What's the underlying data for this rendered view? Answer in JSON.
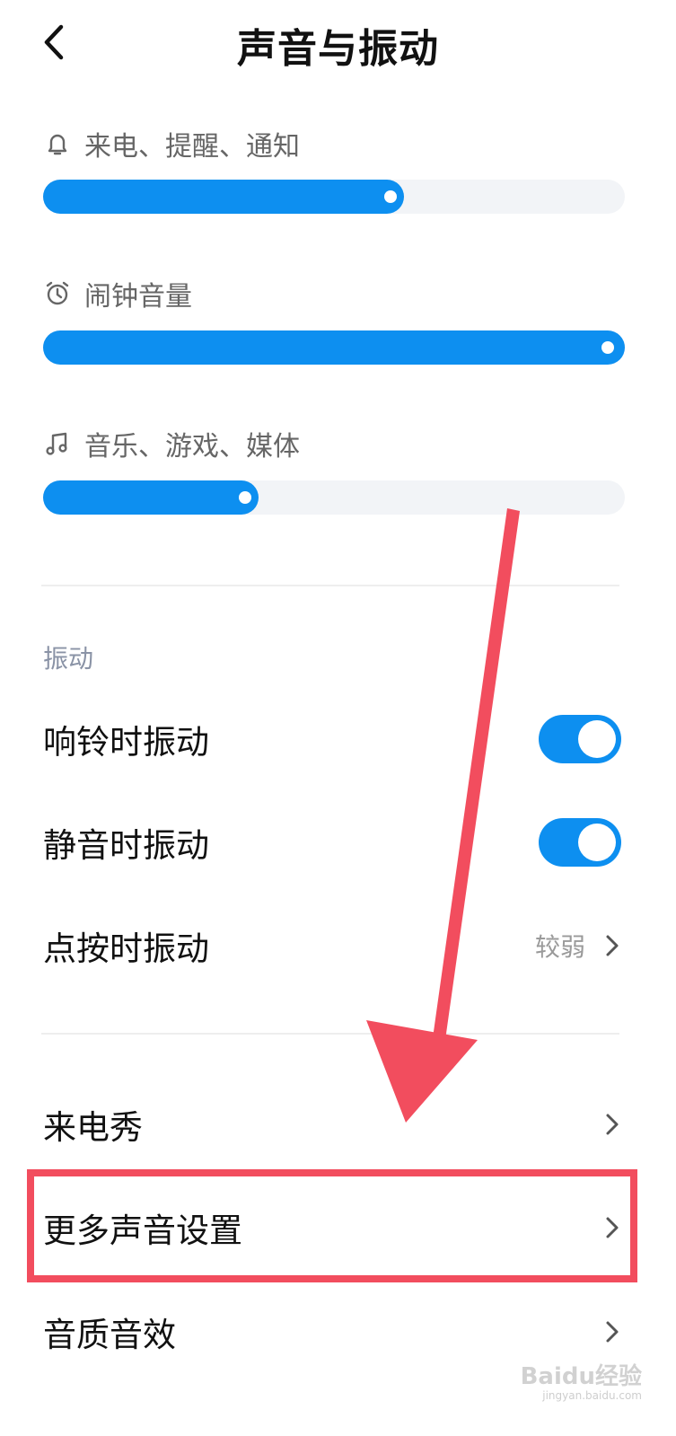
{
  "header": {
    "title": "声音与振动",
    "back_icon": "chevron-left-icon"
  },
  "volume": [
    {
      "label": "来电、提醒、通知",
      "icon": "bell-icon",
      "level_percent": 62
    },
    {
      "label": "闹钟音量",
      "icon": "alarm-clock-icon",
      "level_percent": 100
    },
    {
      "label": "音乐、游戏、媒体",
      "icon": "music-note-icon",
      "level_percent": 37
    }
  ],
  "vibration": {
    "section_title": "振动",
    "ring_vibrate": {
      "label": "响铃时振动",
      "on": true
    },
    "silent_vibrate": {
      "label": "静音时振动",
      "on": true
    },
    "touch_vibrate": {
      "label": "点按时振动",
      "value": "较弱"
    }
  },
  "menu": [
    {
      "label": "来电秀"
    },
    {
      "label": "更多声音设置"
    },
    {
      "label": "音质音效"
    }
  ],
  "colors": {
    "accent": "#0d8ff0",
    "annotation": "#f24d5e",
    "track": "#f2f4f7"
  },
  "watermark": {
    "text": "Baidu经验",
    "sub": "jingyan.baidu.com"
  }
}
